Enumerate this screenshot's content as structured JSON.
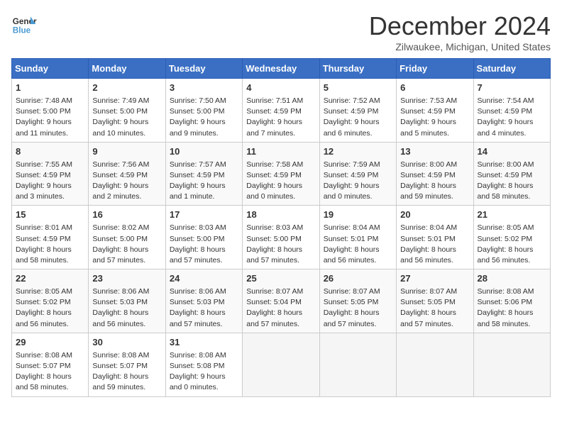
{
  "header": {
    "logo_line1": "General",
    "logo_line2": "Blue",
    "title": "December 2024",
    "location": "Zilwaukee, Michigan, United States"
  },
  "days_of_week": [
    "Sunday",
    "Monday",
    "Tuesday",
    "Wednesday",
    "Thursday",
    "Friday",
    "Saturday"
  ],
  "weeks": [
    [
      {
        "day": 1,
        "rise": "7:48 AM",
        "set": "5:00 PM",
        "daylight": "9 hours and 11 minutes."
      },
      {
        "day": 2,
        "rise": "7:49 AM",
        "set": "5:00 PM",
        "daylight": "9 hours and 10 minutes."
      },
      {
        "day": 3,
        "rise": "7:50 AM",
        "set": "5:00 PM",
        "daylight": "9 hours and 9 minutes."
      },
      {
        "day": 4,
        "rise": "7:51 AM",
        "set": "4:59 PM",
        "daylight": "9 hours and 7 minutes."
      },
      {
        "day": 5,
        "rise": "7:52 AM",
        "set": "4:59 PM",
        "daylight": "9 hours and 6 minutes."
      },
      {
        "day": 6,
        "rise": "7:53 AM",
        "set": "4:59 PM",
        "daylight": "9 hours and 5 minutes."
      },
      {
        "day": 7,
        "rise": "7:54 AM",
        "set": "4:59 PM",
        "daylight": "9 hours and 4 minutes."
      }
    ],
    [
      {
        "day": 8,
        "rise": "7:55 AM",
        "set": "4:59 PM",
        "daylight": "9 hours and 3 minutes."
      },
      {
        "day": 9,
        "rise": "7:56 AM",
        "set": "4:59 PM",
        "daylight": "9 hours and 2 minutes."
      },
      {
        "day": 10,
        "rise": "7:57 AM",
        "set": "4:59 PM",
        "daylight": "9 hours and 1 minute."
      },
      {
        "day": 11,
        "rise": "7:58 AM",
        "set": "4:59 PM",
        "daylight": "9 hours and 0 minutes."
      },
      {
        "day": 12,
        "rise": "7:59 AM",
        "set": "4:59 PM",
        "daylight": "9 hours and 0 minutes."
      },
      {
        "day": 13,
        "rise": "8:00 AM",
        "set": "4:59 PM",
        "daylight": "8 hours and 59 minutes."
      },
      {
        "day": 14,
        "rise": "8:00 AM",
        "set": "4:59 PM",
        "daylight": "8 hours and 58 minutes."
      }
    ],
    [
      {
        "day": 15,
        "rise": "8:01 AM",
        "set": "4:59 PM",
        "daylight": "8 hours and 58 minutes."
      },
      {
        "day": 16,
        "rise": "8:02 AM",
        "set": "5:00 PM",
        "daylight": "8 hours and 57 minutes."
      },
      {
        "day": 17,
        "rise": "8:03 AM",
        "set": "5:00 PM",
        "daylight": "8 hours and 57 minutes."
      },
      {
        "day": 18,
        "rise": "8:03 AM",
        "set": "5:00 PM",
        "daylight": "8 hours and 57 minutes."
      },
      {
        "day": 19,
        "rise": "8:04 AM",
        "set": "5:01 PM",
        "daylight": "8 hours and 56 minutes."
      },
      {
        "day": 20,
        "rise": "8:04 AM",
        "set": "5:01 PM",
        "daylight": "8 hours and 56 minutes."
      },
      {
        "day": 21,
        "rise": "8:05 AM",
        "set": "5:02 PM",
        "daylight": "8 hours and 56 minutes."
      }
    ],
    [
      {
        "day": 22,
        "rise": "8:05 AM",
        "set": "5:02 PM",
        "daylight": "8 hours and 56 minutes."
      },
      {
        "day": 23,
        "rise": "8:06 AM",
        "set": "5:03 PM",
        "daylight": "8 hours and 56 minutes."
      },
      {
        "day": 24,
        "rise": "8:06 AM",
        "set": "5:03 PM",
        "daylight": "8 hours and 57 minutes."
      },
      {
        "day": 25,
        "rise": "8:07 AM",
        "set": "5:04 PM",
        "daylight": "8 hours and 57 minutes."
      },
      {
        "day": 26,
        "rise": "8:07 AM",
        "set": "5:05 PM",
        "daylight": "8 hours and 57 minutes."
      },
      {
        "day": 27,
        "rise": "8:07 AM",
        "set": "5:05 PM",
        "daylight": "8 hours and 57 minutes."
      },
      {
        "day": 28,
        "rise": "8:08 AM",
        "set": "5:06 PM",
        "daylight": "8 hours and 58 minutes."
      }
    ],
    [
      {
        "day": 29,
        "rise": "8:08 AM",
        "set": "5:07 PM",
        "daylight": "8 hours and 58 minutes."
      },
      {
        "day": 30,
        "rise": "8:08 AM",
        "set": "5:07 PM",
        "daylight": "8 hours and 59 minutes."
      },
      {
        "day": 31,
        "rise": "8:08 AM",
        "set": "5:08 PM",
        "daylight": "9 hours and 0 minutes."
      },
      null,
      null,
      null,
      null
    ]
  ]
}
